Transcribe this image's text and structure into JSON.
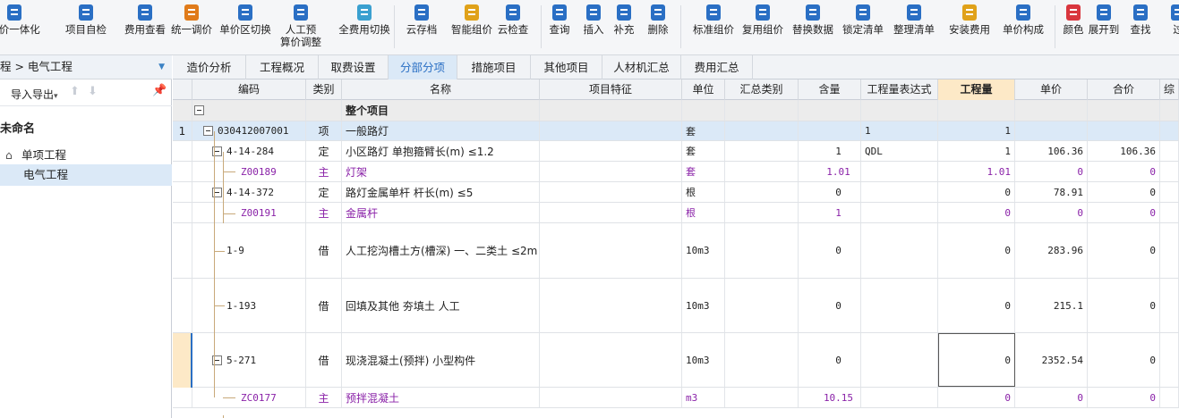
{
  "toolbar": {
    "items": [
      {
        "label": "量价一体化",
        "icon": "sync-icon"
      },
      {
        "label": "项目自检",
        "icon": "check-icon"
      },
      {
        "label": "费用查看",
        "icon": "money-icon"
      },
      {
        "label": "统一调价",
        "icon": "adjust-icon"
      },
      {
        "label": "单价区切换",
        "icon": "switch-icon"
      },
      {
        "label": "人工预",
        "label2": "算价调整",
        "icon": "person-icon"
      },
      {
        "label": "全费用切换",
        "icon": "fee-icon"
      },
      {
        "label": "云存档",
        "icon": "cloud-icon"
      },
      {
        "label": "智能组价",
        "icon": "ai-icon"
      },
      {
        "label": "云检查",
        "icon": "cloud-check-icon"
      },
      {
        "label": "查询",
        "icon": "search-icon"
      },
      {
        "label": "插入",
        "icon": "insert-icon"
      },
      {
        "label": "补充",
        "icon": "supplement-icon"
      },
      {
        "label": "删除",
        "icon": "delete-icon"
      },
      {
        "label": "标准组价",
        "icon": "standard-icon"
      },
      {
        "label": "复用组价",
        "icon": "reuse-icon"
      },
      {
        "label": "替换数据",
        "icon": "replace-icon"
      },
      {
        "label": "锁定清单",
        "icon": "lock-icon"
      },
      {
        "label": "整理清单",
        "icon": "organize-icon"
      },
      {
        "label": "安装费用",
        "icon": "install-icon"
      },
      {
        "label": "单价构成",
        "icon": "price-icon"
      },
      {
        "label": "颜色",
        "icon": "color-icon"
      },
      {
        "label": "展开到",
        "icon": "expand-icon"
      },
      {
        "label": "查找",
        "icon": "find-icon"
      },
      {
        "label": "过",
        "icon": "filter-icon"
      }
    ]
  },
  "left": {
    "breadcrumb": "程 > 电气工程",
    "import_label": "导入导出",
    "project_name": "未命名",
    "unit_project": "单项工程",
    "selected_item": "电气工程"
  },
  "tabs": [
    "造价分析",
    "工程概况",
    "取费设置",
    "分部分项",
    "措施项目",
    "其他项目",
    "人材机汇总",
    "费用汇总"
  ],
  "active_tab": 3,
  "columns": [
    "编码",
    "类别",
    "名称",
    "项目特征",
    "单位",
    "汇总类别",
    "含量",
    "工程量表达式",
    "工程量",
    "单价",
    "合价",
    "综"
  ],
  "rows": [
    {
      "no": "",
      "code": "",
      "type": "",
      "name": "整个项目",
      "unit": "",
      "qty_ratio": "",
      "expr": "",
      "qty": "",
      "price": "",
      "total": ""
    },
    {
      "no": "1",
      "code": "030412007001",
      "type": "项",
      "name": "一般路灯",
      "unit": "套",
      "qty_ratio": "",
      "expr": "1",
      "qty": "1",
      "price": "",
      "total": ""
    },
    {
      "no": "",
      "code": "4-14-284",
      "type": "定",
      "name": "小区路灯 单抱箍臂长(m) ≤1.2",
      "unit": "套",
      "qty_ratio": "1",
      "expr": "QDL",
      "qty": "1",
      "price": "106.36",
      "total": "106.36"
    },
    {
      "no": "",
      "code": "Z00189",
      "type": "主",
      "name": "灯架",
      "unit": "套",
      "qty_ratio": "1.01",
      "expr": "",
      "qty": "1.01",
      "price": "0",
      "total": "0"
    },
    {
      "no": "",
      "code": "4-14-372",
      "type": "定",
      "name": "路灯金属单杆 杆长(m) ≤5",
      "unit": "根",
      "qty_ratio": "0",
      "expr": "",
      "qty": "0",
      "price": "78.91",
      "total": "0"
    },
    {
      "no": "",
      "code": "Z00191",
      "type": "主",
      "name": "金属杆",
      "unit": "根",
      "qty_ratio": "1",
      "expr": "",
      "qty": "0",
      "price": "0",
      "total": "0"
    },
    {
      "no": "",
      "code": "1-9",
      "type": "借",
      "name": "人工挖沟槽土方(槽深) 一、二类土 ≤2m",
      "unit": "10m3",
      "qty_ratio": "0",
      "expr": "",
      "qty": "0",
      "price": "283.96",
      "total": "0"
    },
    {
      "no": "",
      "code": "1-193",
      "type": "借",
      "name": "回填及其他 夯填土 人工",
      "unit": "10m3",
      "qty_ratio": "0",
      "expr": "",
      "qty": "0",
      "price": "215.1",
      "total": "0"
    },
    {
      "no": "",
      "code": "5-271",
      "type": "借",
      "name": "现浇混凝土(预拌) 小型构件",
      "unit": "10m3",
      "qty_ratio": "0",
      "expr": "",
      "qty": "0",
      "price": "2352.54",
      "total": "0"
    },
    {
      "no": "",
      "code": "ZC0177",
      "type": "主",
      "name": "预拌混凝土",
      "unit": "m3",
      "qty_ratio": "10.15",
      "expr": "",
      "qty": "0",
      "price": "0",
      "total": "0"
    }
  ]
}
